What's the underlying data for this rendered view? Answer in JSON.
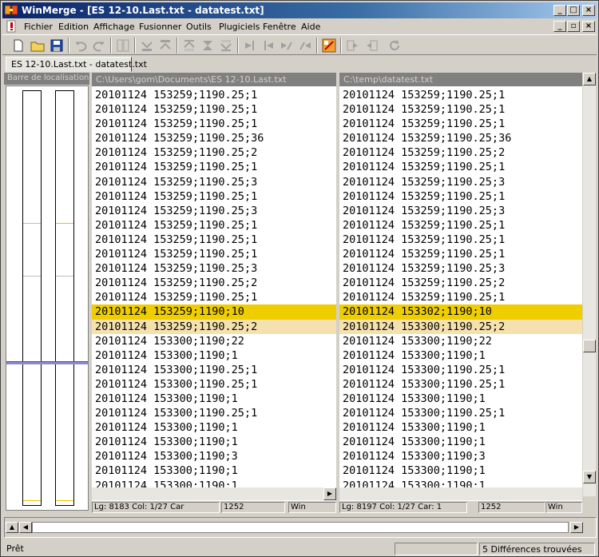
{
  "window": {
    "title": "WinMerge - [ES 12-10.Last.txt - datatest.txt]"
  },
  "menu": {
    "items": [
      "Fichier",
      "Edition",
      "Affichage",
      "Fusionner",
      "Outils",
      "Plugiciels",
      "Fenêtre",
      "Aide"
    ]
  },
  "tab": {
    "label": "ES 12-10.Last.txt - datatest.txt"
  },
  "location_pane": {
    "title": "Barre de localisation"
  },
  "left_pane": {
    "path": "C:\\Users\\gom\\Documents\\ES 12-10.Last.txt",
    "lines": [
      "20101124 153259;1190.25;1",
      "20101124 153259;1190.25;1",
      "20101124 153259;1190.25;1",
      "20101124 153259;1190.25;36",
      "20101124 153259;1190.25;2",
      "20101124 153259;1190.25;1",
      "20101124 153259;1190.25;3",
      "20101124 153259;1190.25;1",
      "20101124 153259;1190.25;3",
      "20101124 153259;1190.25;1",
      "20101124 153259;1190.25;1",
      "20101124 153259;1190.25;1",
      "20101124 153259;1190.25;3",
      "20101124 153259;1190.25;2",
      "20101124 153259;1190.25;1",
      "20101124 153259;1190;10",
      "20101124 153259;1190.25;2",
      "20101124 153300;1190;22",
      "20101124 153300;1190;1",
      "20101124 153300;1190.25;1",
      "20101124 153300;1190.25;1",
      "20101124 153300;1190;1",
      "20101124 153300;1190.25;1",
      "20101124 153300;1190;1",
      "20101124 153300;1190;1",
      "20101124 153300;1190;3",
      "20101124 153300;1190;1",
      "20101124 153300;1190;1"
    ],
    "status": {
      "position": "Lg: 8183  Col: 1/27  Car",
      "codepage": "1252",
      "eol": "Win"
    }
  },
  "right_pane": {
    "path": "C:\\temp\\datatest.txt",
    "lines": [
      "20101124 153259;1190.25;1",
      "20101124 153259;1190.25;1",
      "20101124 153259;1190.25;1",
      "20101124 153259;1190.25;36",
      "20101124 153259;1190.25;2",
      "20101124 153259;1190.25;1",
      "20101124 153259;1190.25;3",
      "20101124 153259;1190.25;1",
      "20101124 153259;1190.25;3",
      "20101124 153259;1190.25;1",
      "20101124 153259;1190.25;1",
      "20101124 153259;1190.25;1",
      "20101124 153259;1190.25;3",
      "20101124 153259;1190.25;2",
      "20101124 153259;1190.25;1",
      "20101124 153302;1190;10",
      "20101124 153300;1190.25;2",
      "20101124 153300;1190;22",
      "20101124 153300;1190;1",
      "20101124 153300;1190.25;1",
      "20101124 153300;1190.25;1",
      "20101124 153300;1190;1",
      "20101124 153300;1190.25;1",
      "20101124 153300;1190;1",
      "20101124 153300;1190;1",
      "20101124 153300;1190;3",
      "20101124 153300;1190;1",
      "20101124 153300;1190;1"
    ],
    "status": {
      "position": "Lg: 8197  Col: 1/27  Car: 1",
      "codepage": "1252",
      "eol": "Win"
    }
  },
  "diff_lines": [
    15,
    16
  ],
  "colors": {
    "diff_block": "#efce00",
    "diff_word": "#f5e1ad",
    "pane_header": "#808080"
  },
  "statusbar": {
    "ready": "Prêt",
    "differences": "5 Différences trouvées"
  }
}
